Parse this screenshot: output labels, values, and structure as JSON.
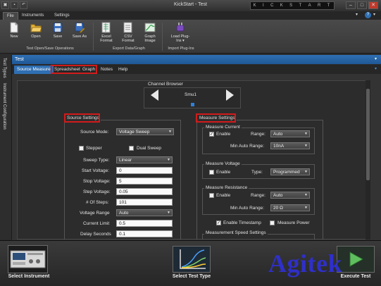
{
  "window": {
    "title": "KickStart - Test",
    "brand_letters": [
      "K",
      "I",
      "C",
      "K",
      "S",
      "T",
      "A",
      "R",
      "T"
    ]
  },
  "menu": {
    "tabs": [
      "File",
      "Instruments",
      "Settings"
    ]
  },
  "ribbon": {
    "buttons": [
      {
        "label": "New",
        "icon": "new-document-icon"
      },
      {
        "label": "Open",
        "icon": "open-folder-icon"
      },
      {
        "label": "Save",
        "icon": "save-disk-icon"
      },
      {
        "label": "Save As",
        "icon": "save-as-icon"
      },
      {
        "label": "Excel Format",
        "icon": "excel-icon"
      },
      {
        "label": "CSV Format",
        "icon": "csv-icon"
      },
      {
        "label": "Graph Image",
        "icon": "graph-image-icon"
      },
      {
        "label": "Load Plug-Ins ▾",
        "icon": "plugin-icon"
      }
    ],
    "groups": [
      "Test Open/Save Operations",
      "Export Data/Graph",
      "Import Plug-Ins"
    ]
  },
  "test_header": "Test",
  "left_tabs": [
    "Test Types",
    "Instrument Configuration"
  ],
  "sub_tabs": [
    "Source Measure",
    "Spreadsheet",
    "Graph",
    "Notes",
    "Help"
  ],
  "channel_browser": {
    "title": "Channel Browser",
    "channel": "Smu1"
  },
  "source_settings": {
    "title": "Source Settings",
    "source_mode_label": "Source Mode:",
    "source_mode": "Voltage Sweep",
    "stepper_label": "Stepper",
    "dual_sweep_label": "Dual Sweep",
    "fields": [
      {
        "label": "Sweep Type:",
        "value": "Linear",
        "kind": "select"
      },
      {
        "label": "Start Voltage:",
        "value": "0",
        "kind": "text"
      },
      {
        "label": "Stop Voltage:",
        "value": "5",
        "kind": "text"
      },
      {
        "label": "Step Voltage:",
        "value": "0.05",
        "kind": "text"
      },
      {
        "label": "# Of Steps:",
        "value": "101",
        "kind": "text"
      },
      {
        "label": "Voltage Range",
        "value": "Auto",
        "kind": "select"
      },
      {
        "label": "Current Limit",
        "value": "0.5",
        "kind": "text"
      },
      {
        "label": "Delay Seconds",
        "value": "0.1",
        "kind": "text"
      }
    ]
  },
  "measure_settings": {
    "title": "Measure Settings",
    "current": {
      "title": "Measure Current",
      "enable_label": "Enable",
      "enabled": true,
      "range_label": "Range:",
      "range": "Auto",
      "min_label": "Min Auto Range:",
      "min": "10nA"
    },
    "voltage": {
      "title": "Measure Voltage",
      "enable_label": "Enable",
      "enabled": false,
      "type_label": "Type:",
      "type": "Programmed"
    },
    "resistance": {
      "title": "Measure Resistance",
      "enable_label": "Enable",
      "enabled": false,
      "range_label": "Range:",
      "range": "Auto",
      "min_label": "Min Auto Range:",
      "min": "20 Ω"
    },
    "timestamp_label": "Enable Timestamp",
    "timestamp_enabled": true,
    "power_label": "Measure Power",
    "power_enabled": false,
    "speed_title": "Measurement Speed Settings"
  },
  "bottom": {
    "select_instrument": "Select Instrument",
    "select_test_type": "Select Test Type",
    "execute_test": "Execute Test"
  },
  "watermark": "Agitek"
}
